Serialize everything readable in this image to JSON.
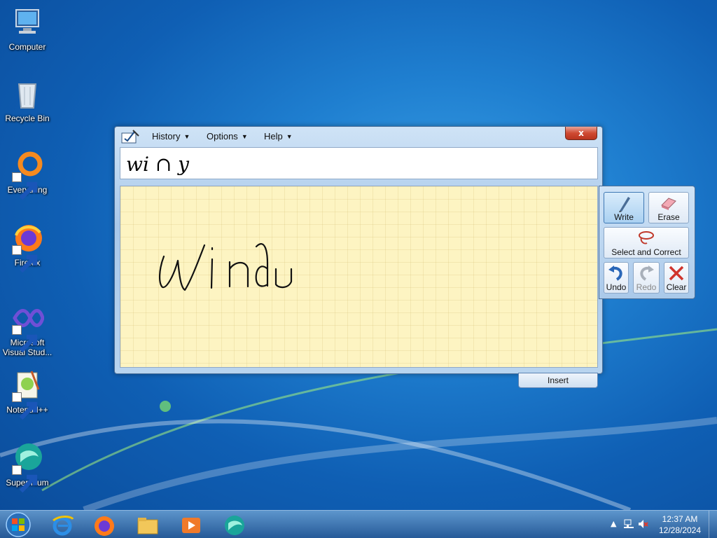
{
  "desktop": {
    "icons": [
      {
        "label": "Computer"
      },
      {
        "label": "Recycle Bin"
      },
      {
        "label": "Everything"
      },
      {
        "label": "Firefox"
      },
      {
        "label": "Microsoft Visual Stud..."
      },
      {
        "label": "Notepad++"
      },
      {
        "label": "Supermium"
      }
    ]
  },
  "tip": {
    "menus": [
      "History",
      "Options",
      "Help"
    ],
    "close_label": "x",
    "recognized_text": "wi ∩ y",
    "insert_label": "Insert",
    "tools": {
      "write": "Write",
      "erase": "Erase",
      "select_correct": "Select and Correct",
      "undo": "Undo",
      "redo": "Redo",
      "clear": "Clear"
    }
  },
  "taskbar": {
    "apps": [
      "internet-explorer",
      "firefox",
      "file-explorer",
      "media-player",
      "supermium"
    ],
    "time": "12:37 AM",
    "date": "12/28/2024"
  },
  "colors": {
    "pad_background": "#fdf4c2",
    "accent": "#1f7fd0",
    "close_red": "#cf4a32"
  }
}
